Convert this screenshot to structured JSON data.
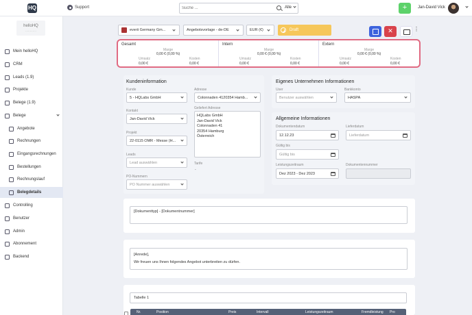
{
  "topbar": {
    "logo": "HQ",
    "support_label": "Support",
    "search_placeholder": "Suche ...",
    "search_filter": "Alle",
    "add_label": "+",
    "username": "Jan-David Vick"
  },
  "sidebar": {
    "org_logo": "helloHQ",
    "items": [
      {
        "label": "Mein helloHQ"
      },
      {
        "label": "CRM"
      },
      {
        "label": "Leads (1.9)"
      },
      {
        "label": "Projekte"
      },
      {
        "label": "Belege (1.9)"
      },
      {
        "label": "Belege"
      },
      {
        "label": "Angebote"
      },
      {
        "label": "Rechnungen"
      },
      {
        "label": "Eingangsrechnungen"
      },
      {
        "label": "Bestellungen"
      },
      {
        "label": "Rechnungslauf"
      },
      {
        "label": "Belegdetails"
      },
      {
        "label": "Controlling"
      },
      {
        "label": "Benutzer"
      },
      {
        "label": "Admin"
      },
      {
        "label": "Abonnement"
      },
      {
        "label": "Backend"
      }
    ]
  },
  "toolbar": {
    "company": "everii Germany Gm...",
    "template": "Angebotsvorlage - de-DE",
    "currency": "EUR (€)",
    "status": "Draft",
    "cancel_label": "✕",
    "more_label": "⋮"
  },
  "summary": {
    "columns": [
      {
        "title": "Gesamt",
        "marge_label": "Marge",
        "marge_value": "0,00 € (0,00 %)",
        "umsatz_label": "Umsatz",
        "umsatz_value": "0,00 €",
        "kosten_label": "Kosten",
        "kosten_value": "0,00 €"
      },
      {
        "title": "Intern",
        "marge_label": "Marge",
        "marge_value": "0,00 € (0,00 %)",
        "umsatz_label": "Umsatz",
        "umsatz_value": "0,00 €",
        "kosten_label": "Kosten",
        "kosten_value": "0,00 €"
      },
      {
        "title": "Extern",
        "marge_label": "Marge",
        "marge_value": "0,00 € (0,00 %)",
        "umsatz_label": "Umsatz",
        "umsatz_value": "0,00 €",
        "kosten_label": "Kosten",
        "kosten_value": "0,00 €"
      }
    ]
  },
  "kunden": {
    "title": "Kundeninformation",
    "kunde_label": "Kunde",
    "kunde_value": "5 - HQLabs GmbH",
    "adresse_label": "Adresse",
    "adresse_value": "Colonnaden 4120354 Hamb...",
    "kontakt_label": "Kontakt",
    "kontakt_value": "Jan-David Vick",
    "geliefert_label": "Geliefert Adresse",
    "address_lines": [
      "HQLabs GmbH",
      "Jan-David Vick",
      "Colonnaden 41",
      "20354 Hamburg",
      "Österreich"
    ],
    "projekt_label": "Projekt",
    "projekt_value": "22-0115 OMR - Messe (H...",
    "leads_label": "Leads",
    "leads_placeholder": "Lead auswählen",
    "tarife_label": "Tarife",
    "tarife_value": "-",
    "po_label": "PO-Nummern",
    "po_placeholder": "PO Nummer auswählen"
  },
  "eigen": {
    "title": "Eigenes Unternehmen Informationen",
    "user_label": "User",
    "user_placeholder": "Benutzer auswählen",
    "bank_label": "Bankkonto",
    "bank_value": "HASPA"
  },
  "allgemein": {
    "title": "Allgemeine Informationen",
    "dokdatum_label": "Dokumentendatum",
    "dokdatum_value": "12.12.23",
    "lieferdatum_label": "Lieferdatum",
    "lieferdatum_placeholder": "Lieferdatum",
    "gueltig_label": "Gültig bis",
    "gueltig_placeholder": "Gültig bis",
    "leistung_label": "Leistungszeitraum",
    "leistung_value": "Dez 2023 - Dez 2023",
    "doknummer_label": "Dokumentennummer"
  },
  "doc": {
    "title_field": "[Dokumenttyp] - [Dokumentnummer]",
    "anrede": "[Anrede],",
    "intro": "Wir freuen uns Ihnen folgendes Angebot unterbreiten zu dürfen.",
    "table_name": "Tabelle 1"
  },
  "table": {
    "headers": [
      "Nr.",
      "Position",
      "Preis",
      "Intervall",
      "Leistungszeitraum",
      "Fremdleistung",
      "Pro"
    ]
  }
}
